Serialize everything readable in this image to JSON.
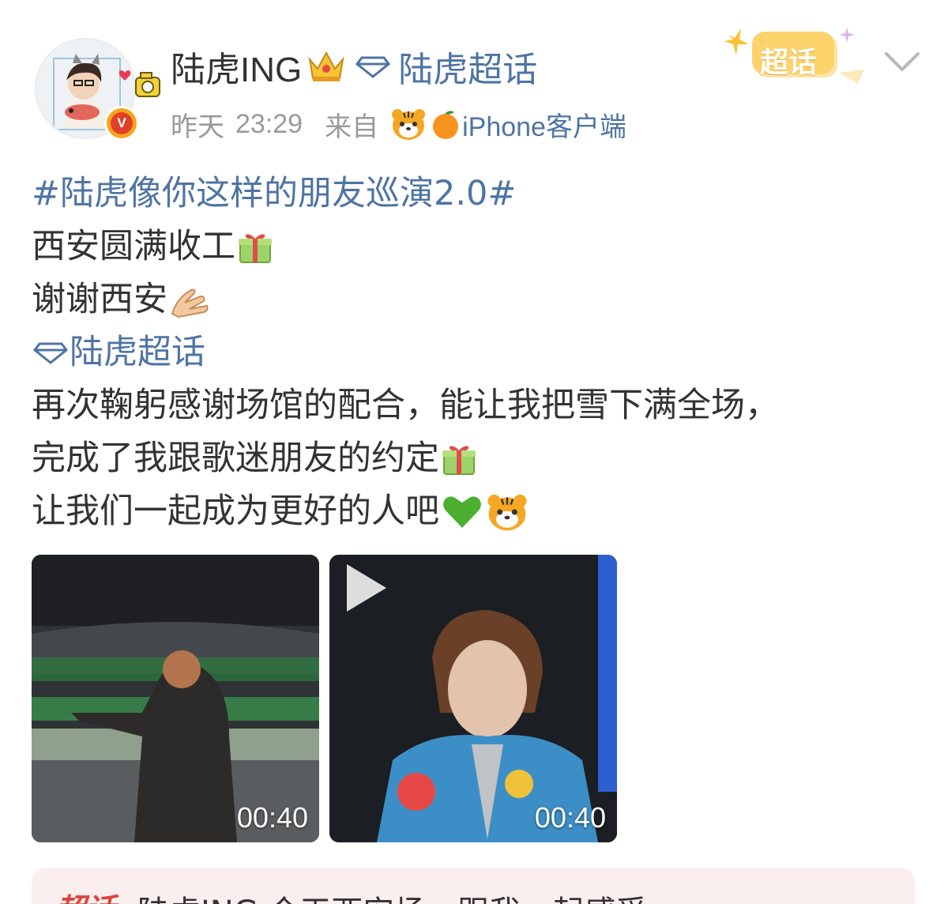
{
  "post": {
    "author": {
      "name": "陆虎ING",
      "topic": "陆虎超话"
    },
    "meta": {
      "date": "昨天",
      "time": "23:29",
      "from_label": "来自",
      "client": "iPhone客户端"
    },
    "super_badge_label": "超话",
    "lines": {
      "hashtag": "#陆虎像你这样的朋友巡演2.0#",
      "line2": "西安圆满收工",
      "line3": "谢谢西安",
      "topic": "陆虎超话",
      "line5": "再次鞠躬感谢场馆的配合，能让我把雪下满全场，",
      "line6": "完成了我跟歌迷朋友的约定",
      "line7": "让我们一起成为更好的人吧"
    },
    "media": [
      {
        "duration": "00:40"
      },
      {
        "duration": "00:40"
      }
    ],
    "bottom_card": {
      "badge": "超话",
      "text": "陆虎ING    今天西安场，跟我一起感受"
    }
  },
  "colors": {
    "link": "#4f74a4",
    "text": "#333333",
    "meta": "#9a9a9a",
    "card_bg": "#fbeeee"
  }
}
